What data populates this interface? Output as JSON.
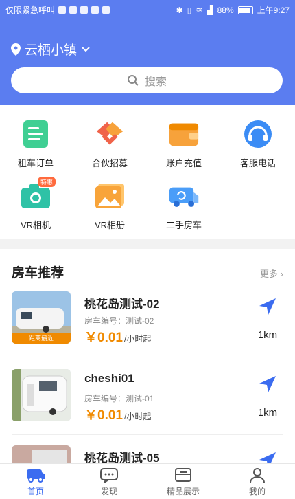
{
  "status_bar": {
    "carrier": "仅限紧急呼叫",
    "battery": "88%",
    "time": "上午9:27"
  },
  "header": {
    "location": "云栖小镇",
    "search_placeholder": "搜索"
  },
  "services": [
    {
      "label": "租车订单",
      "icon": "rental-order-icon",
      "color": "#3fcf93"
    },
    {
      "label": "合伙招募",
      "icon": "partner-recruit-icon",
      "color": "#f0634a"
    },
    {
      "label": "账户充值",
      "icon": "wallet-icon",
      "color": "#f7a23b"
    },
    {
      "label": "客服电话",
      "icon": "headset-icon",
      "color": "#3b8cf5"
    },
    {
      "label": "VR相机",
      "icon": "camera-icon",
      "color": "#2fc2a6",
      "badge": "特惠"
    },
    {
      "label": "VR相册",
      "icon": "album-icon",
      "color": "#f8a43a"
    },
    {
      "label": "二手房车",
      "icon": "rv-icon",
      "color": "#4a9df8"
    }
  ],
  "recommend": {
    "title": "房车推荐",
    "more": "更多",
    "items": [
      {
        "title": "桃花岛测试-02",
        "number": "房车编号：测试-02",
        "price": "￥0.01",
        "unit": "/小时起",
        "distance": "1km",
        "tag": "距离最近"
      },
      {
        "title": "cheshi01",
        "number": "房车编号：测试-01",
        "price": "￥0.01",
        "unit": "/小时起",
        "distance": "1km"
      },
      {
        "title": "桃花岛测试-05",
        "number": "",
        "price": "",
        "unit": "",
        "distance": ""
      }
    ]
  },
  "tabs": [
    {
      "label": "首页",
      "icon": "home-rv-icon",
      "active": true
    },
    {
      "label": "发现",
      "icon": "discover-chat-icon",
      "active": false
    },
    {
      "label": "精品展示",
      "icon": "showcase-icon",
      "active": false
    },
    {
      "label": "我的",
      "icon": "user-icon",
      "active": false
    }
  ],
  "colors": {
    "primary": "#5b7df0",
    "price": "#f08a00",
    "nav_arrow": "#3b6cf0"
  }
}
